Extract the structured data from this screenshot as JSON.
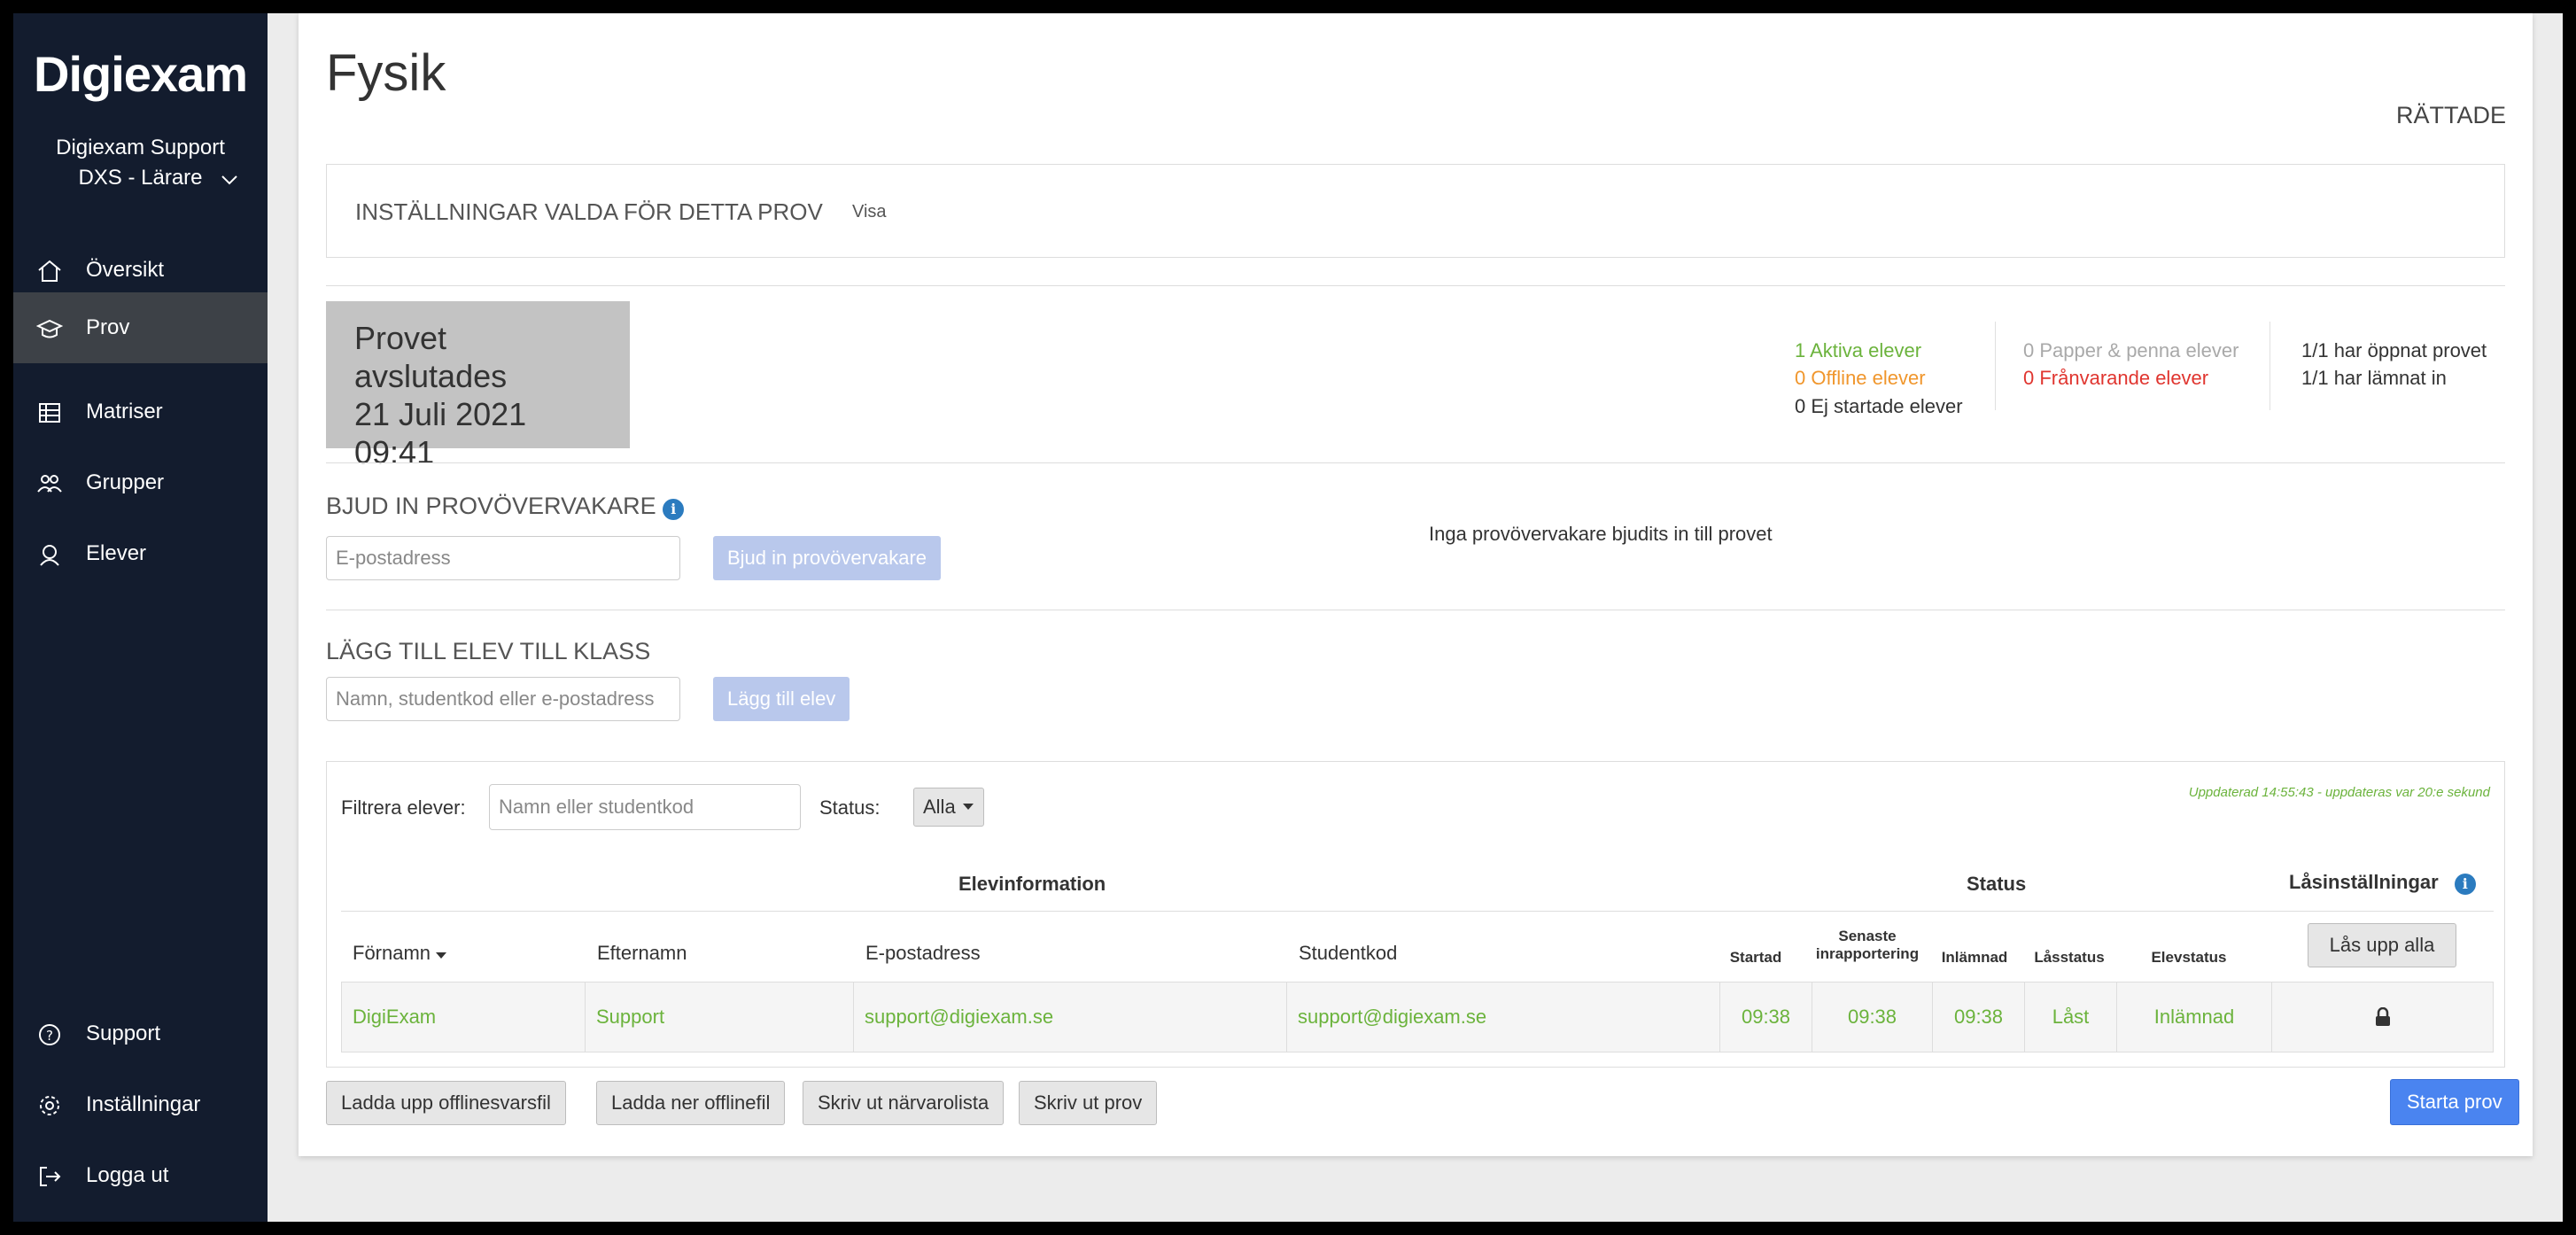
{
  "app": {
    "logo": "Digiexam"
  },
  "user": {
    "name": "Digiexam Support",
    "role": "DXS - Lärare"
  },
  "nav": {
    "top": [
      {
        "label": "Översikt",
        "icon": "home-icon"
      },
      {
        "label": "Prov",
        "icon": "graduation-cap-icon",
        "active": true
      },
      {
        "label": "Matriser",
        "icon": "table-icon"
      },
      {
        "label": "Grupper",
        "icon": "groups-icon"
      },
      {
        "label": "Elever",
        "icon": "student-icon"
      }
    ],
    "bottom": [
      {
        "label": "Support",
        "icon": "help-icon"
      },
      {
        "label": "Inställningar",
        "icon": "gear-icon"
      },
      {
        "label": "Logga ut",
        "icon": "logout-icon"
      }
    ]
  },
  "page": {
    "title": "Fysik",
    "status_label": "RÄTTADE"
  },
  "settings": {
    "title": "INSTÄLLNINGAR VALDA FÖR DETTA PROV",
    "link": "Visa"
  },
  "exam_end": {
    "line1": "Provet avslutades",
    "line2": "21 Juli 2021",
    "line3": "09:41"
  },
  "stats": {
    "active": "1 Aktiva elever",
    "offline": "0 Offline elever",
    "not_started": "0 Ej startade elever",
    "paper": "0 Papper & penna elever",
    "absent": "0 Frånvarande elever",
    "opened": "1/1 har öppnat provet",
    "submitted": "1/1 har lämnat in",
    "colors": {
      "green": "#6bb33c",
      "orange": "#f0962c",
      "red": "#e0352f",
      "grey": "#a9a9a9"
    }
  },
  "invite": {
    "title": "BJUD IN PROVÖVERVAKARE",
    "placeholder": "E-postadress",
    "button": "Bjud in provövervakare",
    "empty_text": "Inga provövervakare bjudits in till provet"
  },
  "add_student": {
    "title": "LÄGG TILL ELEV TILL KLASS",
    "placeholder": "Namn, studentkod eller e-postadress",
    "button": "Lägg till elev"
  },
  "students": {
    "filter_label": "Filtrera elever:",
    "filter_placeholder": "Namn eller studentkod",
    "status_label": "Status:",
    "status_value": "Alla",
    "updated": "Uppdaterad 14:55:43 - uppdateras var 20:e sekund",
    "group_headers": {
      "info": "Elevinformation",
      "status": "Status",
      "lock": "Låsinställningar"
    },
    "columns": {
      "first": "Förnamn",
      "last": "Efternamn",
      "email": "E-postadress",
      "code": "Studentkod",
      "started": "Startad",
      "last_report_1": "Senaste",
      "last_report_2": "inrapportering",
      "submitted": "Inlämnad",
      "lock_status": "Låsstatus",
      "student_status": "Elevstatus"
    },
    "unlock_all": "Lås upp alla",
    "rows": [
      {
        "first": "DigiExam",
        "last": "Support",
        "email": "support@digiexam.se",
        "code": "support@digiexam.se",
        "started": "09:38",
        "last_report": "09:38",
        "submitted": "09:38",
        "lock_status": "Låst",
        "student_status": "Inlämnad"
      }
    ]
  },
  "footer_buttons": {
    "upload": "Ladda upp offlinesvarsfil",
    "download": "Ladda ner offlinefil",
    "print_attendance": "Skriv ut närvarolista",
    "print_exam": "Skriv ut prov",
    "start": "Starta prov"
  }
}
